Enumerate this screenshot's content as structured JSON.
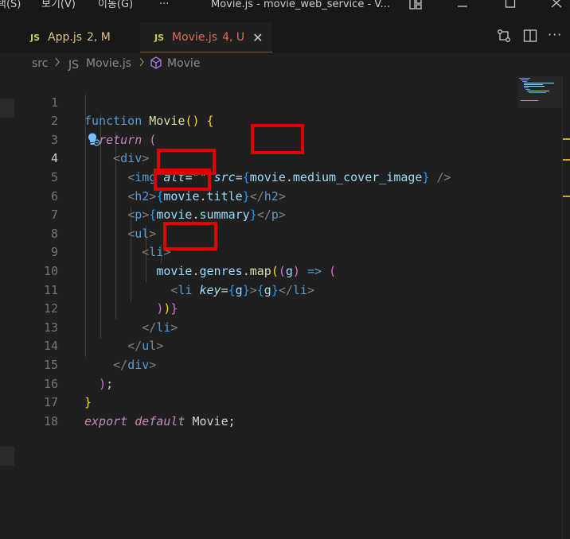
{
  "window": {
    "menu": [
      "택(S)",
      "보기(V)",
      "이동(G)",
      "···"
    ],
    "title": "Movie.js - movie_web_service - V..."
  },
  "tabs": [
    {
      "lang": "JS",
      "name": "App.js",
      "status": "2, M"
    },
    {
      "lang": "JS",
      "name": "Movie.js",
      "status": "4, U"
    }
  ],
  "breadcrumb": {
    "folder": "src",
    "file_lang": "JS",
    "file": "Movie.js",
    "symbol": "Movie"
  },
  "editor": {
    "line_numbers": [
      "1",
      "2",
      "3",
      "4",
      "5",
      "6",
      "7",
      "8",
      "9",
      "10",
      "11",
      "12",
      "13",
      "14",
      "15",
      "16",
      "17",
      "18"
    ],
    "current_line": 4,
    "code": {
      "l1_kw": "function",
      "l1_fn": "Movie",
      "l2_kw": "return",
      "l3_tag": "div",
      "l4_tag": "img",
      "l4_attr1": "alt",
      "l4_str": "\"\"",
      "l4_attr2": "src",
      "l4_obj": "movie",
      "l4_prop": "medium_cover_image",
      "l5_tag": "h2",
      "l5_obj": "movie",
      "l5_prop": "title",
      "l6_tag": "p",
      "l6_obj": "movie",
      "l6_prop": "summary",
      "l7_tag": "ul",
      "l8_tag": "li",
      "l9_obj": "movie",
      "l9_prop": "genres",
      "l9_fn": "map",
      "l9_param": "g",
      "l10_tag": "li",
      "l10_attr": "key",
      "l10_var": "g",
      "l10_var2": "g",
      "l17_kw1": "export",
      "l17_kw2": "default",
      "l17_name": "Movie"
    }
  }
}
